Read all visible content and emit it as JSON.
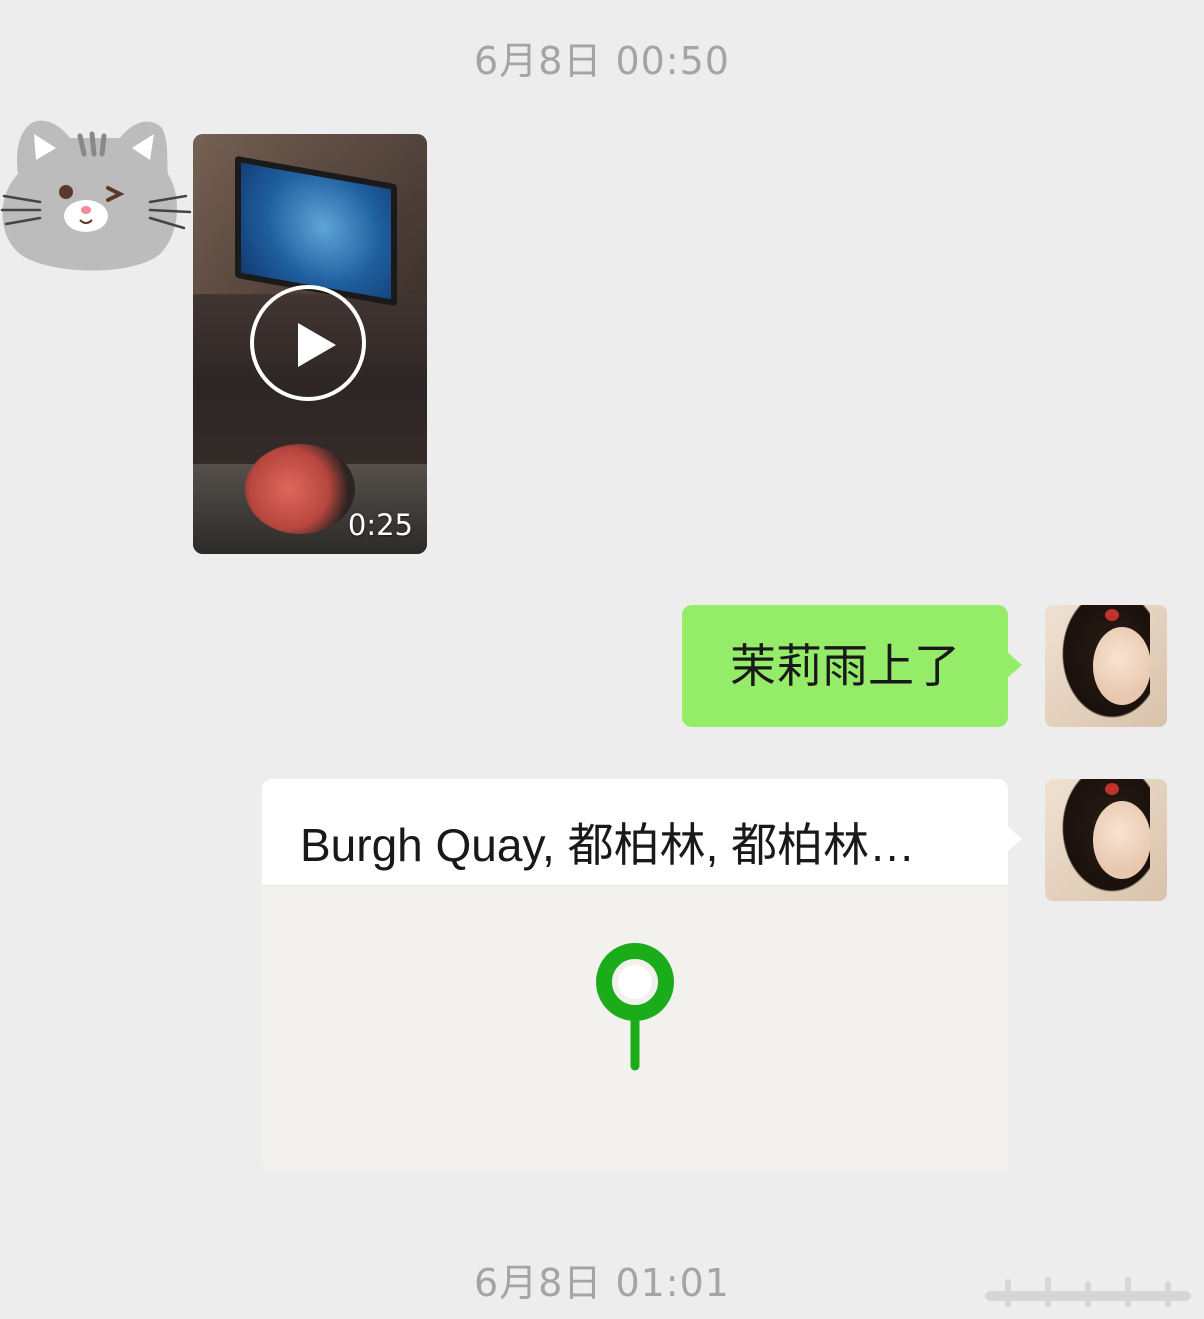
{
  "timestamps": [
    "6月8日 00:50",
    "6月8日 01:01"
  ],
  "messages": {
    "video": {
      "duration": "0:25",
      "sender_avatar": "cat-sticker-avatar"
    },
    "text": {
      "content": "茉莉雨上了",
      "bubble_color": "#95ec69"
    },
    "location": {
      "title": "Burgh Quay, 都柏林, 都柏林…",
      "pin_icon": "map-pin-icon",
      "pin_color": "#1aad19"
    }
  },
  "colors": {
    "background": "#ededed",
    "timestamp": "#a4a4a4"
  }
}
